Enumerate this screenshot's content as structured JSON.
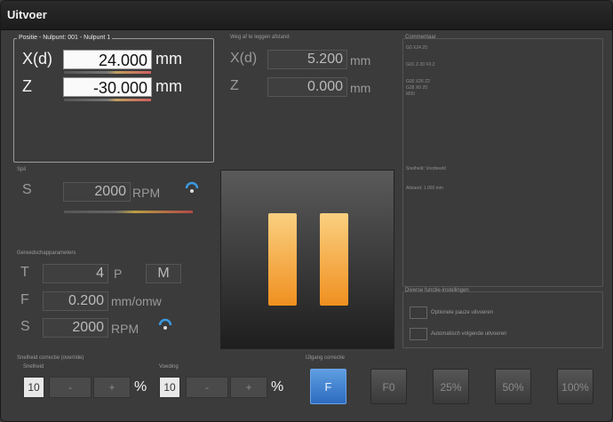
{
  "window": {
    "title": "Uitvoer"
  },
  "position": {
    "group_title": "Positie - Nulpunt: 001 - Nulpunt 1",
    "x": {
      "label": "X(d)",
      "value": "24.000",
      "unit": "mm"
    },
    "z": {
      "label": "Z",
      "value": "-30.000",
      "unit": "mm"
    }
  },
  "distance": {
    "group_title": "Weg af te leggen afstand",
    "x": {
      "label": "X(d)",
      "value": "5.200",
      "unit": "mm"
    },
    "z": {
      "label": "Z",
      "value": "0.000",
      "unit": "mm"
    }
  },
  "spindle": {
    "group_title": "Spil",
    "label": "S",
    "value": "2000",
    "unit": "RPM"
  },
  "tool": {
    "group_title": "Gereedschapparameters",
    "t_label": "T",
    "t_value": "4",
    "p_label": "P",
    "m_label": "M",
    "f_label": "F",
    "f_value": "0.200",
    "f_unit": "mm/omw",
    "s_label": "S",
    "s_value": "2000",
    "s_unit": "RPM"
  },
  "comments": {
    "group_title": "Commentaar",
    "lines": [
      "G0 X24 Z0",
      "G01 Z-30 F0.2",
      "G00 X26 Z2",
      "G28 X0 Z0",
      "M30"
    ],
    "extra1": "Snelheid: Voorbeeld",
    "extra2": "Afstand: 1.000 mm"
  },
  "options": {
    "group_title": "Diverse functie-instellingen",
    "opt1": "Optionele pauze uitvoeren",
    "opt2": "Automatisch volgende uitvoeren"
  },
  "overrides": {
    "group_title": "Snelheid correctie (override)",
    "speed_label": "Snelheid",
    "speed_value": "10",
    "feed_label": "Voeding",
    "feed_value": "10",
    "minus": "-",
    "plus": "+",
    "percent": "%"
  },
  "rapid": {
    "group_title": "IJlgang correctie",
    "buttons": [
      "F",
      "F0",
      "25%",
      "50%",
      "100%"
    ]
  }
}
